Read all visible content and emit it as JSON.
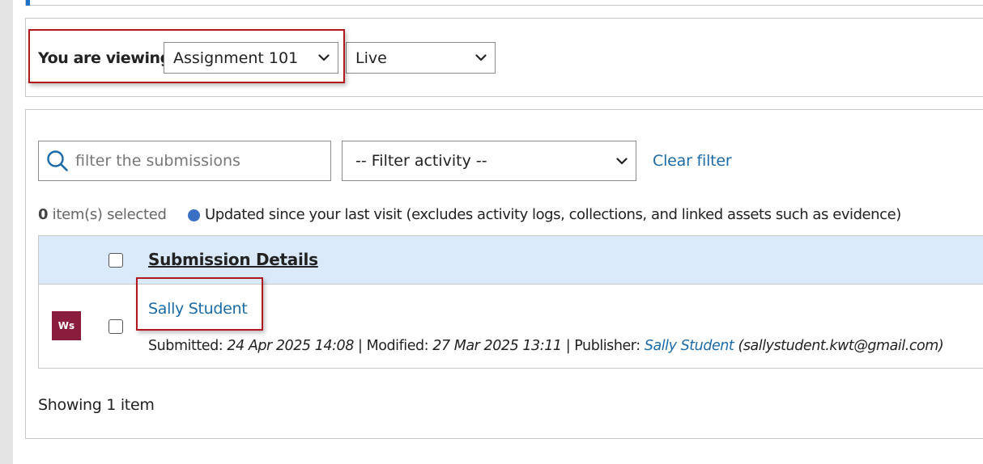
{
  "viewing": {
    "label": "You are viewing:",
    "assignment_select": "Assignment 101",
    "status_select": "Live"
  },
  "filters": {
    "search_placeholder": "filter the submissions",
    "activity_select": "-- Filter activity --",
    "clear_filter": "Clear filter"
  },
  "selection": {
    "count": "0",
    "count_suffix": " item(s) selected"
  },
  "legend": {
    "text": "Updated since your last visit (excludes activity logs, collections, and linked assets such as evidence)",
    "dot_color": "#3a6fc4"
  },
  "table": {
    "header": "Submission Details",
    "rows": [
      {
        "avatar_text": "Ws",
        "avatar_color": "#8a1c3e",
        "student_name": "Sally Student",
        "submitted_label": "Submitted:",
        "submitted_value": "24 Apr 2025 14:08",
        "modified_label": "Modified:",
        "modified_value": "27 Mar 2025 13:11",
        "publisher_label": "Publisher:",
        "publisher_name": "Sally Student",
        "publisher_email": "(sallystudent.kwt@gmail.com)",
        "separator": "|"
      }
    ]
  },
  "footer": {
    "showing": "Showing 1 item"
  },
  "colors": {
    "link": "#1c6ba8",
    "highlight_border": "#b0181e",
    "header_bg": "#dbeafa"
  }
}
